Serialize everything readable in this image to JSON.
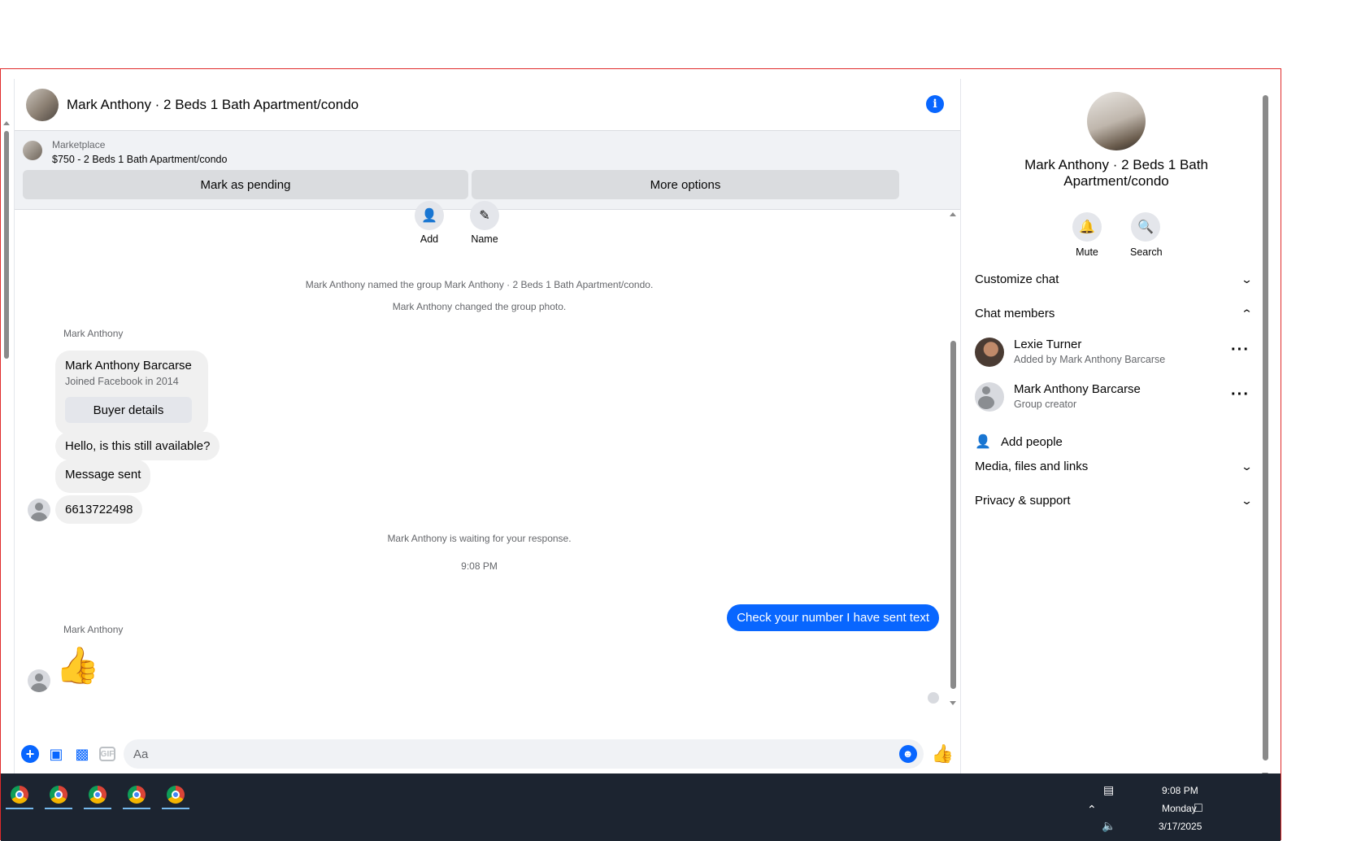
{
  "chat": {
    "title": "Mark Anthony · 2 Beds 1 Bath Apartment/condo",
    "marketplace_label": "Marketplace",
    "listing": "$750 - 2 Beds 1 Bath Apartment/condo",
    "mark_pending": "Mark as pending",
    "more_options": "More options",
    "actions": {
      "add": "Add",
      "name": "Name"
    },
    "system": {
      "named": "Mark Anthony named the group Mark Anthony · 2 Beds 1 Bath Apartment/condo.",
      "photo": "Mark Anthony changed the group photo.",
      "waiting": "Mark Anthony is waiting for your response.",
      "time": "9:08 PM"
    },
    "sender1": "Mark Anthony",
    "card": {
      "name": "Mark Anthony Barcarse",
      "sub": "Joined Facebook in 2014",
      "button": "Buyer details"
    },
    "msg1": "Hello, is this still available?",
    "msg2": "Message sent",
    "msg3": "6613722498",
    "outgoing": "Check your number I have sent text",
    "sender2": "Mark Anthony",
    "placeholder": "Aa"
  },
  "info": {
    "name": "Mark Anthony · 2 Beds 1 Bath Apartment/condo",
    "mute": "Mute",
    "search": "Search",
    "customize": "Customize chat",
    "members_title": "Chat members",
    "members": [
      {
        "name": "Lexie Turner",
        "sub": "Added by Mark Anthony Barcarse"
      },
      {
        "name": "Mark Anthony Barcarse",
        "sub": "Group creator"
      }
    ],
    "add_people": "Add people",
    "media": "Media, files and links",
    "privacy": "Privacy & support"
  },
  "taskbar": {
    "time": "9:08 PM",
    "day": "Monday",
    "date": "3/17/2025"
  },
  "colors": {
    "accent": "#0866ff",
    "taskbar": "#1c2430"
  }
}
